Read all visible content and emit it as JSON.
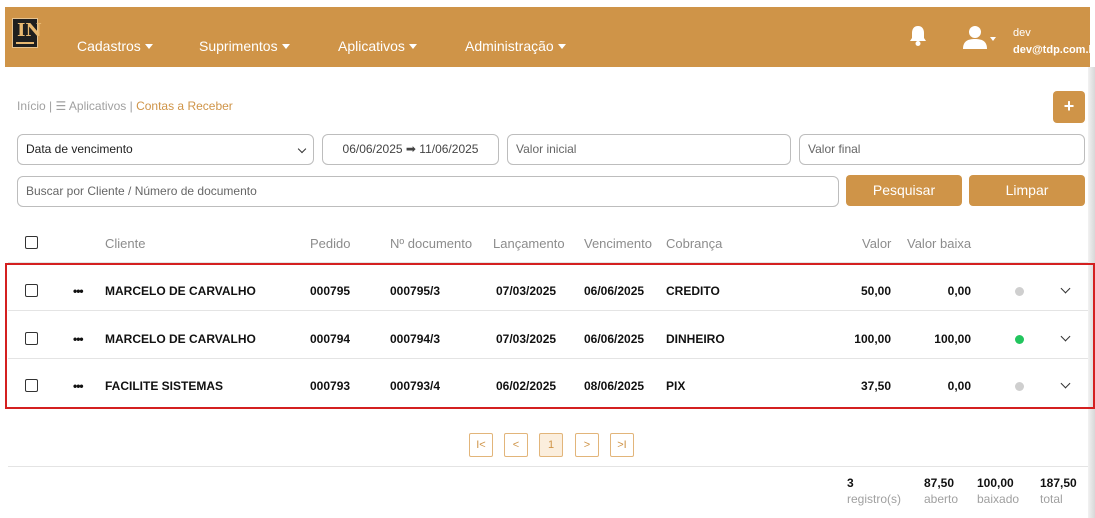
{
  "header": {
    "logo_text": "IN",
    "nav": [
      {
        "label": "Cadastros"
      },
      {
        "label": "Suprimentos"
      },
      {
        "label": "Aplicativos"
      },
      {
        "label": "Administração"
      }
    ],
    "user": {
      "name": "dev",
      "email": "dev@tdp.com.br"
    },
    "icons": {
      "notifications": "bell-icon",
      "user": "user-icon"
    }
  },
  "breadcrumb": {
    "home": "Início |",
    "apps": "☰ Aplicativos |",
    "current": "Contas a Receber"
  },
  "add_button": {
    "label": "+"
  },
  "filters": {
    "date_type": "Data de vencimento",
    "date_range": "06/06/2025 ➡ 11/06/2025",
    "valor_inicial_placeholder": "Valor inicial",
    "valor_final_placeholder": "Valor final",
    "search_placeholder": "Buscar por Cliente / Número de documento",
    "search_button": "Pesquisar",
    "clear_button": "Limpar"
  },
  "table": {
    "columns": [
      "Cliente",
      "Pedido",
      "Nº documento",
      "Lançamento",
      "Vencimento",
      "Cobrança",
      "Valor",
      "Valor baixa"
    ],
    "rows": [
      {
        "actions": "•••",
        "cliente": "MARCELO DE CARVALHO",
        "pedido": "000795",
        "documento": "000795/3",
        "lancamento": "07/03/2025",
        "vencimento": "06/06/2025",
        "cobranca": "CREDITO",
        "valor": "50,00",
        "valor_baixa": "0,00",
        "status_color": "#cfcfcf"
      },
      {
        "actions": "•••",
        "cliente": "MARCELO DE CARVALHO",
        "pedido": "000794",
        "documento": "000794/3",
        "lancamento": "07/03/2025",
        "vencimento": "06/06/2025",
        "cobranca": "DINHEIRO",
        "valor": "100,00",
        "valor_baixa": "100,00",
        "status_color": "#22c55e"
      },
      {
        "actions": "•••",
        "cliente": "FACILITE SISTEMAS",
        "pedido": "000793",
        "documento": "000793/4",
        "lancamento": "06/02/2025",
        "vencimento": "08/06/2025",
        "cobranca": "PIX",
        "valor": "37,50",
        "valor_baixa": "0,00",
        "status_color": "#cfcfcf"
      }
    ]
  },
  "pagination": {
    "first": "I<",
    "prev": "<",
    "current": "1",
    "next": ">",
    "last": ">I"
  },
  "totals": {
    "registros": {
      "value": "3",
      "label": "registro(s)"
    },
    "aberto": {
      "value": "87,50",
      "label": "aberto"
    },
    "baixado": {
      "value": "100,00",
      "label": "baixado"
    },
    "total": {
      "value": "187,50",
      "label": "total"
    }
  },
  "colors": {
    "brand": "#CF9448",
    "highlight": "#d42020"
  }
}
